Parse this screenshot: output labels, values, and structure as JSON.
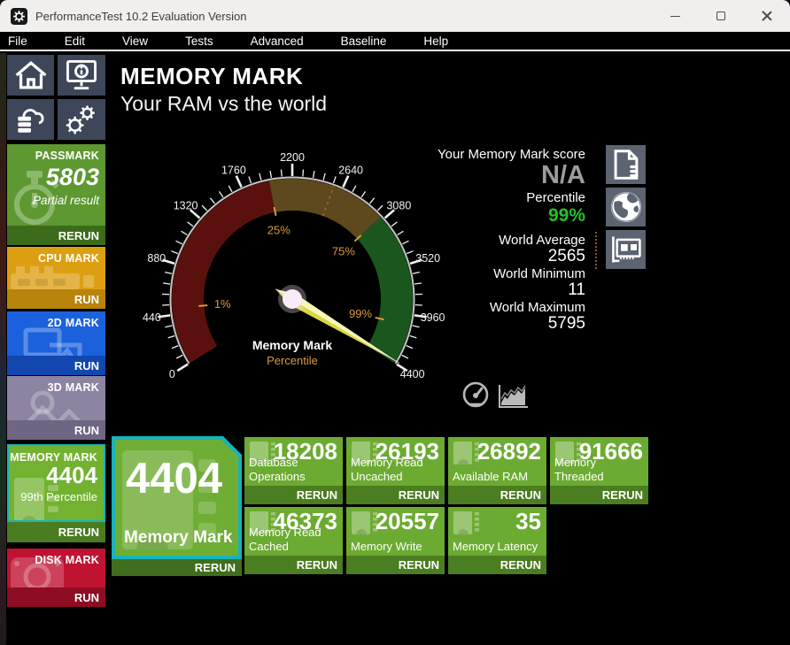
{
  "window": {
    "title": "PerformanceTest 10.2 Evaluation Version",
    "controls": [
      "minimize-icon",
      "maximize-icon",
      "close-icon"
    ]
  },
  "menu": {
    "items": [
      "File",
      "Edit",
      "View",
      "Tests",
      "Advanced",
      "Baseline",
      "Help"
    ]
  },
  "sidebar": {
    "quick_icons": [
      "home-icon",
      "system-info-icon",
      "cloud-database-icon",
      "settings-gears-icon"
    ],
    "tiles": [
      {
        "label": "PASSMARK",
        "value": "5803",
        "subtext": "Partial result",
        "action": "RERUN",
        "color": "#5d9830",
        "icon": "stopwatch-icon",
        "selected": false
      },
      {
        "label": "CPU MARK",
        "action": "RUN",
        "color": "#dd9f12",
        "icon": "cpu-icon",
        "selected": false
      },
      {
        "label": "2D MARK",
        "action": "RUN",
        "color": "#1b61dd",
        "icon": "graphics-2d-icon",
        "selected": false
      },
      {
        "label": "3D MARK",
        "action": "RUN",
        "color": "#8d84a2",
        "icon": "graphics-3d-icon",
        "selected": false
      },
      {
        "label": "MEMORY MARK",
        "value": "4404",
        "subtext": "99th Percentile",
        "action": "RERUN",
        "color": "#72b230",
        "icon": "ram-chip-icon",
        "selected": true
      },
      {
        "label": "DISK MARK",
        "action": "RUN",
        "color": "#bf1331",
        "icon": "disk-icon",
        "selected": false
      }
    ]
  },
  "header": {
    "title": "MEMORY MARK",
    "subtitle": "Your RAM vs the world"
  },
  "chart_data": {
    "type": "gauge",
    "title": "Memory Mark",
    "subtitle": "Percentile",
    "min": 0,
    "max": 4400,
    "major_tick": 440,
    "minor_tick": 88,
    "tick_labels": [
      "0",
      "440",
      "880",
      "1320",
      "1760",
      "2200",
      "2640",
      "3080",
      "3520",
      "3960",
      "4400"
    ],
    "bands": [
      {
        "from": 0,
        "to": 2000,
        "color": "#5a110d"
      },
      {
        "from": 2000,
        "to": 3050,
        "color": "#5e481d"
      },
      {
        "from": 3050,
        "to": 4400,
        "color": "#1a571e"
      }
    ],
    "percentile_markers": [
      {
        "label": "1%",
        "value": 500
      },
      {
        "label": "25%",
        "value": 2000
      },
      {
        "label": "75%",
        "value": 3050
      },
      {
        "label": "99%",
        "value": 4050
      }
    ],
    "world_average_marker": 2565,
    "needle_value": 4380,
    "needle_color": "#d9d93e",
    "label_color": "#d99c3c"
  },
  "view_toggle": [
    "gauge-view-icon",
    "history-chart-view-icon"
  ],
  "score_panel": {
    "score_label": "Your Memory Mark score",
    "score_value": "N/A",
    "percentile_label": "Percentile",
    "percentile_value": "99%",
    "percentile_color": "#20c228",
    "world_stats": [
      {
        "label": "World Average",
        "value": "2565"
      },
      {
        "label": "World Minimum",
        "value": "11"
      },
      {
        "label": "World Maximum",
        "value": "5795"
      }
    ],
    "icons": [
      "baseline-report-icon",
      "world-results-icon",
      "hardware-info-icon"
    ]
  },
  "results": {
    "main_tile": {
      "value": "4404",
      "label": "Memory Mark",
      "action": "RERUN"
    },
    "tiles": [
      {
        "value": "18208",
        "label": "Database Operations",
        "action": "RERUN"
      },
      {
        "value": "26193",
        "label": "Memory Read Uncached",
        "action": "RERUN"
      },
      {
        "value": "26892",
        "label": "Available RAM",
        "action": "RERUN"
      },
      {
        "value": "91666",
        "label": "Memory Threaded",
        "action": "RERUN"
      },
      {
        "value": "46373",
        "label": "Memory Read Cached",
        "action": "RERUN"
      },
      {
        "value": "20557",
        "label": "Memory Write",
        "action": "RERUN"
      },
      {
        "value": "35",
        "label": "Memory Latency",
        "action": "RERUN"
      }
    ]
  },
  "colors": {
    "selected_border": "#17b3b9",
    "result_tile": "#6cab31",
    "result_tile_bar": "#4b7d21",
    "accent_orange": "#d99c3c"
  }
}
